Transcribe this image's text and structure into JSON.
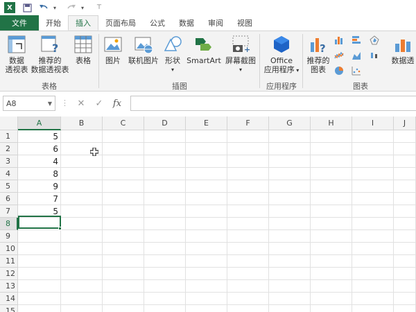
{
  "quick_access": {
    "app_icon_letter": "X",
    "icons": [
      "save-icon",
      "undo-icon",
      "redo-icon",
      "customize-icon"
    ]
  },
  "tabs": [
    {
      "label": "文件",
      "kind": "file"
    },
    {
      "label": "开始"
    },
    {
      "label": "插入",
      "active": true
    },
    {
      "label": "页面布局"
    },
    {
      "label": "公式"
    },
    {
      "label": "数据"
    },
    {
      "label": "审阅"
    },
    {
      "label": "视图"
    }
  ],
  "ribbon": {
    "groups": {
      "tables": "表格",
      "illustrations": "插图",
      "apps": "应用程序",
      "charts": "图表"
    },
    "buttons": {
      "pivot_table_1": "数据",
      "pivot_table_2": "透视表",
      "rec_pivot_1": "推荐的",
      "rec_pivot_2": "数据透视表",
      "table": "表格",
      "picture": "图片",
      "online_picture": "联机图片",
      "shapes": "形状",
      "smartart": "SmartArt",
      "screenshot": "屏幕截图",
      "office_1": "Office",
      "office_2": "应用程序",
      "rec_charts_1": "推荐的",
      "rec_charts_2": "图表",
      "pivot_chart": "数据透"
    }
  },
  "formula_bar": {
    "name_box": "A8",
    "fx": "fx",
    "value": ""
  },
  "grid": {
    "columns": [
      "A",
      "B",
      "C",
      "D",
      "E",
      "F",
      "G",
      "H",
      "I",
      "J"
    ],
    "rows": [
      "1",
      "2",
      "3",
      "4",
      "5",
      "6",
      "7",
      "8",
      "9",
      "10",
      "11",
      "12",
      "13",
      "14",
      "15"
    ],
    "column_a_values": [
      "5",
      "6",
      "4",
      "8",
      "9",
      "7",
      "5"
    ],
    "selected_column": "A",
    "selected_row": "8"
  },
  "colors": {
    "accent": "#217346",
    "ribbon_bg": "#f3f3f3"
  }
}
